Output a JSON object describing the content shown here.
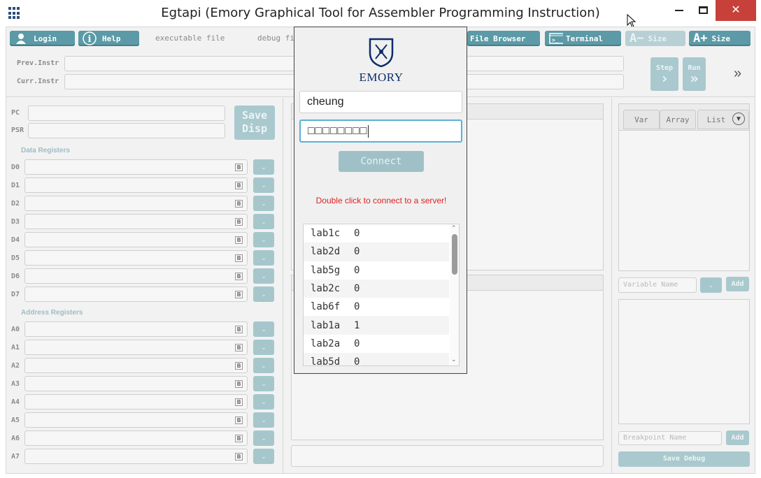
{
  "window": {
    "title": "Egtapi (Emory Graphical Tool for Assembler Programming Instruction)"
  },
  "toolbar": {
    "login": "Login",
    "help": "Help",
    "executable_file": "executable file",
    "debug_file": "debug fi",
    "file_browser": "File Browser",
    "terminal": "Terminal",
    "size_decrease": "Size",
    "size_increase": "Size",
    "step": "Step",
    "run": "Run",
    "more": "»"
  },
  "instr": {
    "prev_label": "Prev.Instr",
    "curr_label": "Curr.Instr"
  },
  "registers": {
    "pc_label": "PC",
    "psr_label": "PSR",
    "save_disp": [
      "Save",
      "Disp"
    ],
    "data_section": "Data Registers",
    "address_section": "Address Registers",
    "data": [
      "D0",
      "D1",
      "D2",
      "D3",
      "D4",
      "D5",
      "D6",
      "D7"
    ],
    "address": [
      "A0",
      "A1",
      "A2",
      "A3",
      "A4",
      "A5",
      "A6",
      "A7"
    ]
  },
  "right_panel": {
    "tabs": [
      "Var",
      "Array",
      "List"
    ],
    "variable_placeholder": "Variable Name",
    "add": "Add",
    "breakpoint_placeholder": "Breakpoint Name",
    "add2": "Add",
    "save_debug": "Save Debug"
  },
  "login_dialog": {
    "logo_text": "EMORY",
    "username": "cheung",
    "password": "□□□□□□□□",
    "connect": "Connect",
    "hint": "Double click to connect to a server!",
    "servers": [
      {
        "name": "lab1c",
        "count": "0"
      },
      {
        "name": "lab2d",
        "count": "0"
      },
      {
        "name": "lab5g",
        "count": "0"
      },
      {
        "name": "lab2c",
        "count": "0"
      },
      {
        "name": "lab6f",
        "count": "0"
      },
      {
        "name": "lab1a",
        "count": "1"
      },
      {
        "name": "lab2a",
        "count": "0"
      },
      {
        "name": "lab5d",
        "count": "0"
      }
    ]
  },
  "icons": {
    "app": "grid-icon",
    "login": "user-icon",
    "help": "info-icon",
    "file_browser": "folder-icon",
    "terminal": "terminal-icon"
  },
  "colors": {
    "accent": "#5b9aa6",
    "accent_disabled": "#a9c9ce",
    "hint": "#dd2222",
    "close": "#c7413a"
  }
}
